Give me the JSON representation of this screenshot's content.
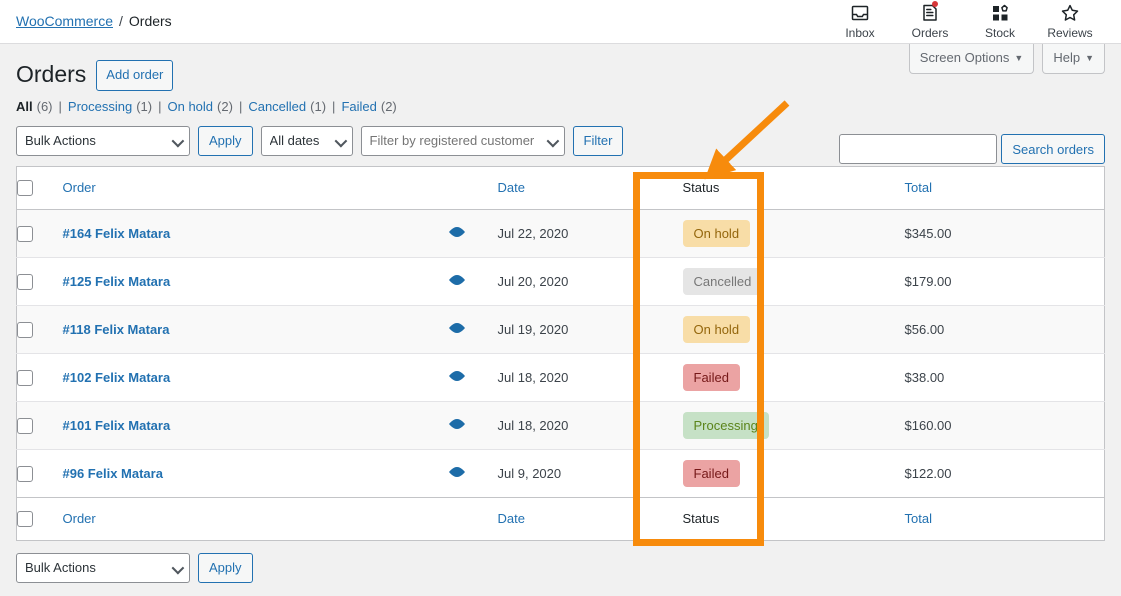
{
  "breadcrumb": {
    "root": "WooCommerce",
    "separator": "/",
    "current": "Orders"
  },
  "nav_icons": [
    {
      "name": "inbox-icon",
      "label": "Inbox",
      "badge": false
    },
    {
      "name": "orders-icon",
      "label": "Orders",
      "badge": true
    },
    {
      "name": "stock-icon",
      "label": "Stock",
      "badge": false
    },
    {
      "name": "reviews-icon",
      "label": "Reviews",
      "badge": false
    }
  ],
  "screen_meta": {
    "screen_options": "Screen Options",
    "help": "Help",
    "caret": "▼"
  },
  "page": {
    "title": "Orders",
    "add_order_label": "Add order"
  },
  "status_filters": [
    {
      "label": "All",
      "count": "(6)",
      "current": true
    },
    {
      "label": "Processing",
      "count": "(1)",
      "current": false
    },
    {
      "label": "On hold",
      "count": "(2)",
      "current": false
    },
    {
      "label": "Cancelled",
      "count": "(1)",
      "current": false
    },
    {
      "label": "Failed",
      "count": "(2)",
      "current": false
    }
  ],
  "filter_separator": "|",
  "search": {
    "value": "",
    "placeholder": "",
    "button_label": "Search orders"
  },
  "tablenav_top": {
    "bulk_actions_label": "Bulk Actions",
    "apply_label": "Apply",
    "dates_label": "All dates",
    "customer_placeholder": "Filter by registered customer",
    "filter_label": "Filter"
  },
  "tablenav_bottom": {
    "bulk_actions_label": "Bulk Actions",
    "apply_label": "Apply"
  },
  "table": {
    "columns": {
      "order": "Order",
      "date": "Date",
      "status": "Status",
      "total": "Total"
    },
    "rows": [
      {
        "order": "#164 Felix Matara",
        "date": "Jul 22, 2020",
        "status": "On hold",
        "status_key": "on-hold",
        "total": "$345.00"
      },
      {
        "order": "#125 Felix Matara",
        "date": "Jul 20, 2020",
        "status": "Cancelled",
        "status_key": "cancelled",
        "total": "$179.00"
      },
      {
        "order": "#118 Felix Matara",
        "date": "Jul 19, 2020",
        "status": "On hold",
        "status_key": "on-hold",
        "total": "$56.00"
      },
      {
        "order": "#102 Felix Matara",
        "date": "Jul 18, 2020",
        "status": "Failed",
        "status_key": "failed",
        "total": "$38.00"
      },
      {
        "order": "#101 Felix Matara",
        "date": "Jul 18, 2020",
        "status": "Processing",
        "status_key": "processing",
        "total": "$160.00"
      },
      {
        "order": "#96 Felix Matara",
        "date": "Jul 9, 2020",
        "status": "Failed",
        "status_key": "failed",
        "total": "$122.00"
      }
    ]
  },
  "status_colors": {
    "on-hold": {
      "bg": "#f8dda7",
      "fg": "#94660c"
    },
    "cancelled": {
      "bg": "#e5e5e5",
      "fg": "#777777"
    },
    "failed": {
      "bg": "#eba3a3",
      "fg": "#761919"
    },
    "processing": {
      "bg": "#c6e1c6",
      "fg": "#5b841b"
    }
  },
  "annotation": {
    "color": "#f78b0c",
    "target": "status-column"
  },
  "theme": {
    "link": "#2271b1",
    "page_bg": "#f1f1f1",
    "table_bg": "#ffffff"
  }
}
